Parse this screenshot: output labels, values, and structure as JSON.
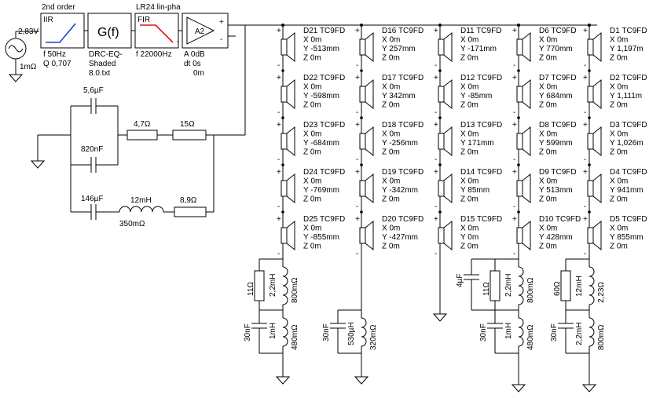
{
  "source": {
    "voltage": "2,83V",
    "resistance": "1mΩ"
  },
  "iir": {
    "header": "2nd order",
    "tag": "IIR",
    "freq": "f   50Hz",
    "q": "Q  0,707",
    "color": "#1f3fd0"
  },
  "gf": {
    "symbol": "G(f)",
    "file_l1": "DRC-EQ-",
    "file_l2": "Shaded",
    "file_l3": "8.0.txt"
  },
  "fir": {
    "header": "LR24 lin-pha",
    "tag": "FIR",
    "freq": "f   22000Hz",
    "color": "#e01515"
  },
  "amp": {
    "name": "A2",
    "gain": "A  0dB",
    "delay": "dt 0s",
    "offset": "0m",
    "plus_in": "+",
    "minus_in": "-",
    "plus_out": "+",
    "minus_out": "-"
  },
  "zobel": {
    "c1": "5,6µF",
    "c2": "820nF",
    "c3": "146µF",
    "r1": "4,7Ω",
    "r2": "15Ω",
    "l1": "12mH",
    "l1_r": "350mΩ",
    "r3": "8,9Ω"
  },
  "drivers": [
    {
      "name": "D21 TC9FD",
      "x": "X 0m",
      "y": "Y -513mm",
      "z": "Z 0m"
    },
    {
      "name": "D22 TC9FD",
      "x": "X 0m",
      "y": "Y -598mm",
      "z": "Z 0m"
    },
    {
      "name": "D23 TC9FD",
      "x": "X 0m",
      "y": "Y -684mm",
      "z": "Z 0m"
    },
    {
      "name": "D24 TC9FD",
      "x": "X 0m",
      "y": "Y -769mm",
      "z": "Z 0m"
    },
    {
      "name": "D25 TC9FD",
      "x": "X 0m",
      "y": "Y -855mm",
      "z": "Z 0m"
    },
    {
      "name": "D16 TC9FD",
      "x": "X 0m",
      "y": "Y 257mm",
      "z": "Z 0m"
    },
    {
      "name": "D17 TC9FD",
      "x": "X 0m",
      "y": "Y 342mm",
      "z": "Z 0m"
    },
    {
      "name": "D18 TC9FD",
      "x": "X 0m",
      "y": "Y -256mm",
      "z": "Z 0m"
    },
    {
      "name": "D19 TC9FD",
      "x": "X 0m",
      "y": "Y -342mm",
      "z": "Z 0m"
    },
    {
      "name": "D20 TC9FD",
      "x": "X 0m",
      "y": "Y -427mm",
      "z": "Z 0m"
    },
    {
      "name": "D11 TC9FD",
      "x": "X 0m",
      "y": "Y -171mm",
      "z": "Z 0m"
    },
    {
      "name": "D12 TC9FD",
      "x": "X 0m",
      "y": "Y -85mm",
      "z": "Z 0m"
    },
    {
      "name": "D13 TC9FD",
      "x": "X 0m",
      "y": "Y 171mm",
      "z": "Z 0m"
    },
    {
      "name": "D14 TC9FD",
      "x": "X 0m",
      "y": "Y 85mm",
      "z": "Z 0m"
    },
    {
      "name": "D15 TC9FD",
      "x": "X 0m",
      "y": "Y 0m",
      "z": "Z 0m"
    },
    {
      "name": "D6 TC9FD",
      "x": "X 0m",
      "y": "Y 770mm",
      "z": "Z 0m"
    },
    {
      "name": "D7 TC9FD",
      "x": "X 0m",
      "y": "Y 684mm",
      "z": "Z 0m"
    },
    {
      "name": "D8 TC9FD",
      "x": "X 0m",
      "y": "Y 599mm",
      "z": "Z 0m"
    },
    {
      "name": "D9 TC9FD",
      "x": "X 0m",
      "y": "Y 513mm",
      "z": "Z 0m"
    },
    {
      "name": "D10 TC9FD",
      "x": "X 0m",
      "y": "Y 428mm",
      "z": "Z 0m"
    },
    {
      "name": "D1 TC9FD",
      "x": "X 0m",
      "y": "Y 1,197m",
      "z": "Z 0m"
    },
    {
      "name": "D2 TC9FD",
      "x": "X 0m",
      "y": "Y 1,111m",
      "z": "Z 0m"
    },
    {
      "name": "D3 TC9FD",
      "x": "X 0m",
      "y": "Y 1,026m",
      "z": "Z 0m"
    },
    {
      "name": "D4 TC9FD",
      "x": "X 0m",
      "y": "Y 941mm",
      "z": "Z 0m"
    },
    {
      "name": "D5 TC9FD",
      "x": "X 0m",
      "y": "Y 855mm",
      "z": "Z 0m"
    }
  ],
  "networks": {
    "col1": {
      "r": "11Ω",
      "l1": "2,2mH",
      "l1_r": "800mΩ",
      "c": "30nF",
      "l2": "1mH",
      "l2_r": "480mΩ"
    },
    "col2": {
      "c": "30nF",
      "l": "530µH",
      "l_r": "320mΩ"
    },
    "col3": {
      "c0": "4µF",
      "r": "11Ω",
      "l1": "2,2mH",
      "l1_r": "800mΩ",
      "c": "30nF",
      "l2": "1mH",
      "l2_r": "480mΩ"
    },
    "col5": {
      "r": "60Ω",
      "l1": "12mH",
      "l1_r": "2,23Ω",
      "c": "30nF",
      "l2": "2,2mH",
      "l2_r": "800mΩ"
    }
  }
}
